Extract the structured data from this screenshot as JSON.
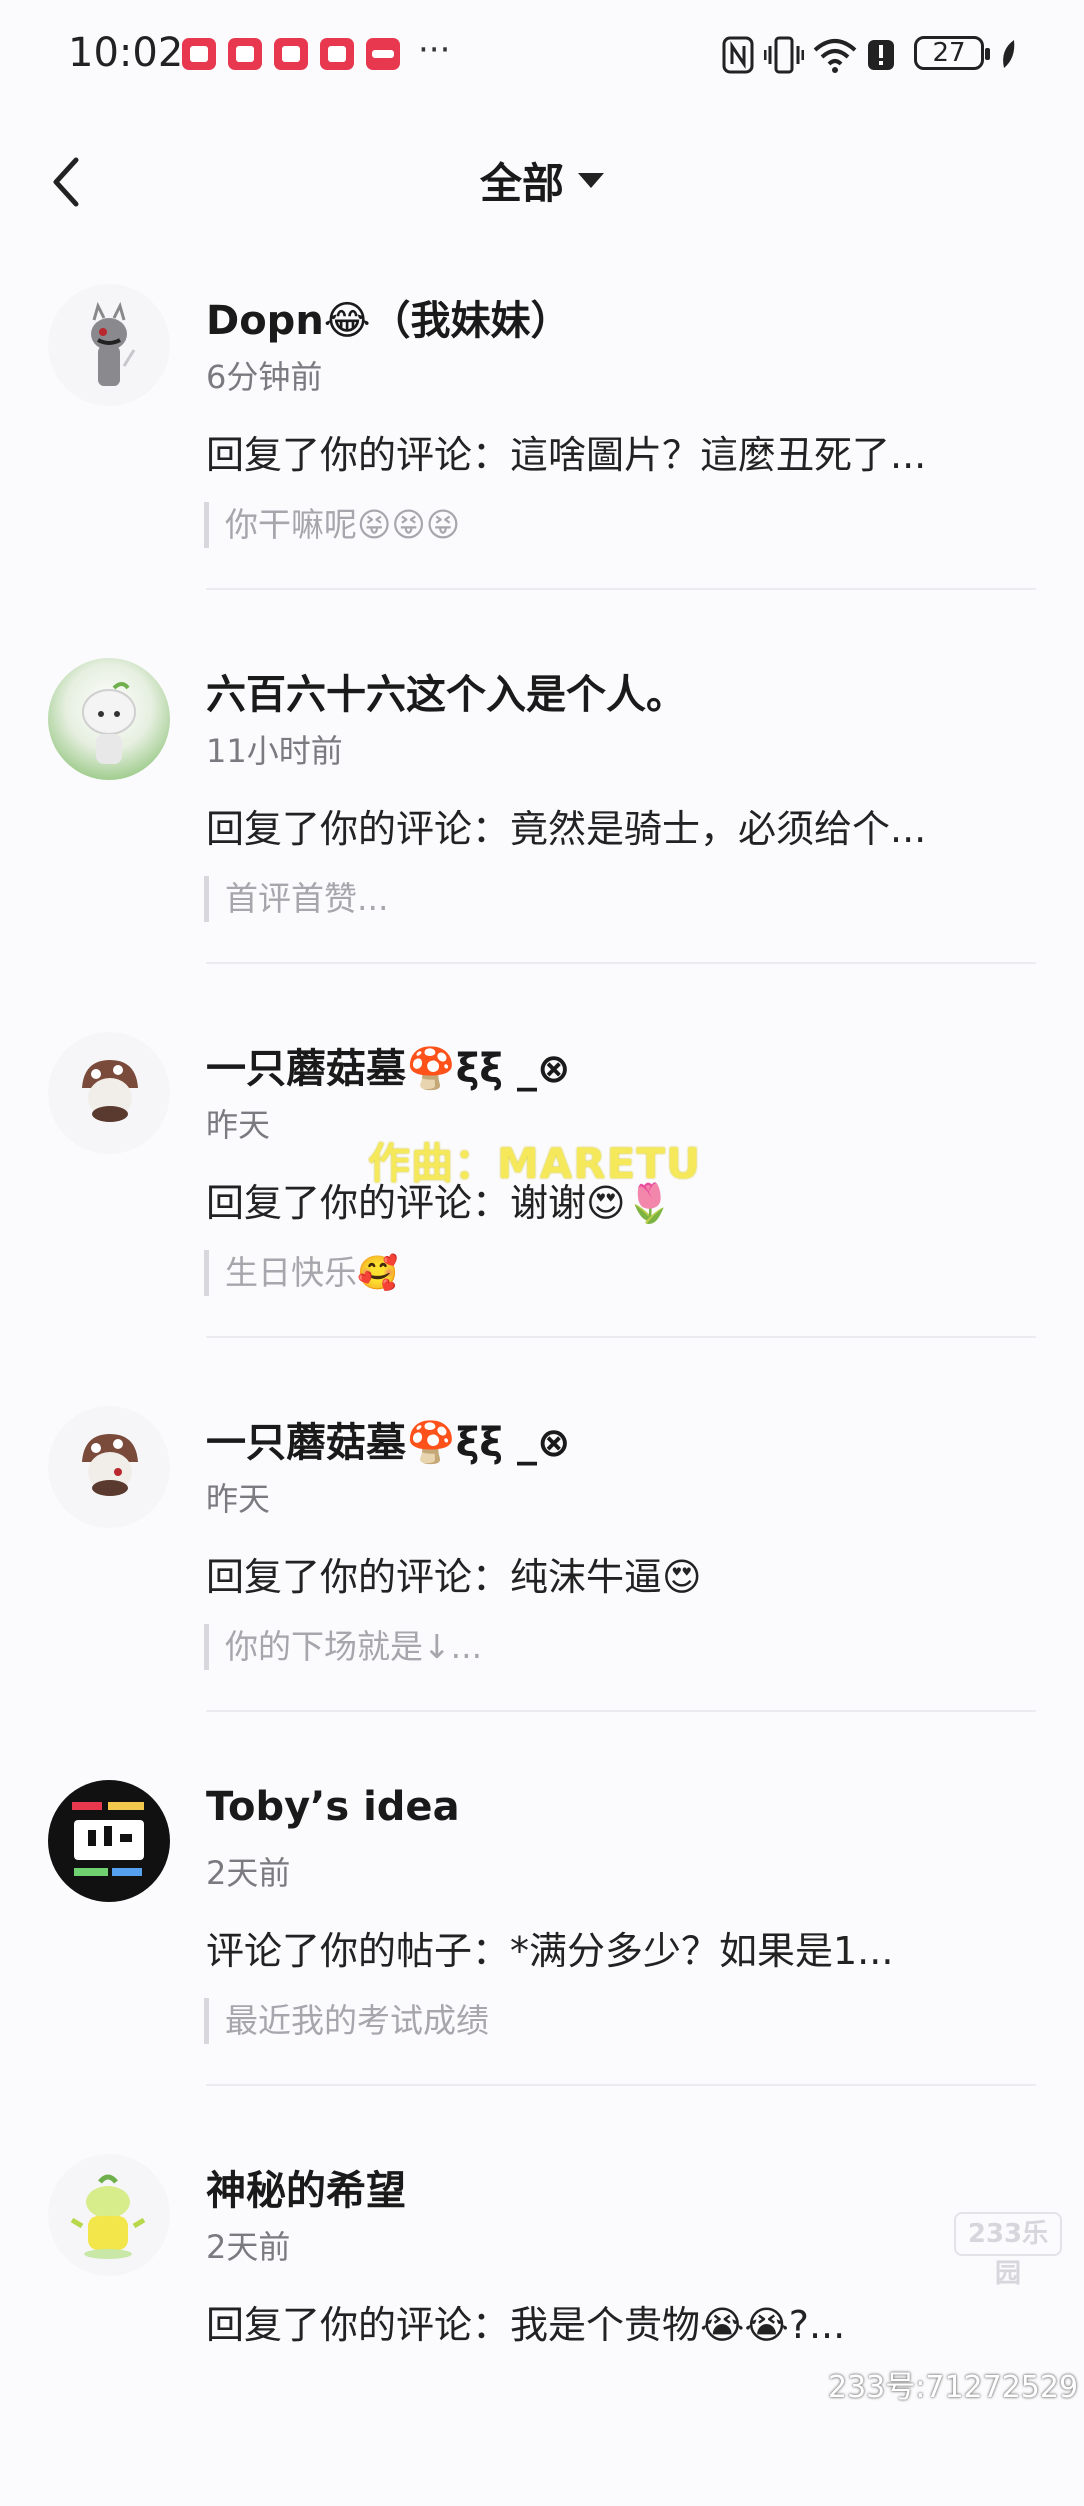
{
  "status_bar": {
    "time": "10:02",
    "more": "···",
    "battery": "27",
    "icons": [
      "app-notification-icon",
      "nfc-icon",
      "vibrate-icon",
      "wifi-icon",
      "alert-icon",
      "battery-icon",
      "leaf-icon"
    ]
  },
  "header": {
    "title": "全部",
    "back_icon": "chevron-left-icon",
    "dropdown_icon": "caret-down-icon"
  },
  "notifications": [
    {
      "name": "Dopn😂（我妹妹）",
      "time": "6分钟前",
      "action": "回复了你的评论：這啥圖片？這麼丑死了...",
      "quote": "你干嘛呢😝😝😝"
    },
    {
      "name": "六百六十六这个入是个人。",
      "time": "11小时前",
      "action": "回复了你的评论：竟然是骑士，必须给个...",
      "quote": "首评首赞..."
    },
    {
      "name": "一只蘑菇墓🍄ξξ _⊗",
      "time": "昨天",
      "action": "回复了你的评论：谢谢😍🌷",
      "quote": "生日快乐🥰"
    },
    {
      "name": "一只蘑菇墓🍄ξξ _⊗",
      "time": "昨天",
      "action": "回复了你的评论：纯沫牛逼😍",
      "quote": "你的下场就是↓..."
    },
    {
      "name": "Toby’s idea",
      "time": "2天前",
      "action": "评论了你的帖子：*满分多少？如果是1...",
      "quote": "最近我的考试成绩"
    },
    {
      "name": "神秘的希望",
      "time": "2天前",
      "action": "回复了你的评论：我是个贵物😭😭?...",
      "quote": ""
    }
  ],
  "avatar_colors": [
    "#b8b8b8",
    "#8fc47a",
    "#7a4a3a",
    "#7a4a3a",
    "#111111",
    "#b7d84b"
  ],
  "overlay_text": "作曲：MARETU",
  "watermark": {
    "logo": "233乐园",
    "id": "233号:71272529"
  }
}
